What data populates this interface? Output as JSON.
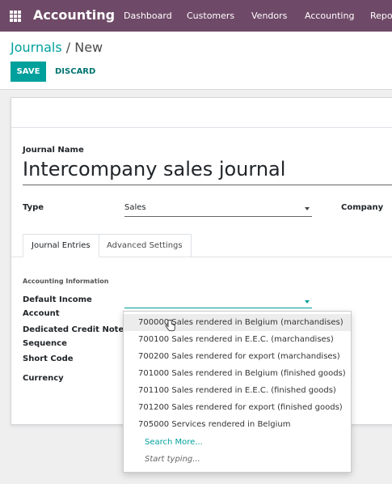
{
  "topbar": {
    "app_title": "Accounting",
    "menu": [
      "Dashboard",
      "Customers",
      "Vendors",
      "Accounting",
      "Reporting"
    ]
  },
  "breadcrumb": {
    "parent": "Journals",
    "separator": " / ",
    "current": "New"
  },
  "buttons": {
    "save": "SAVE",
    "discard": "DISCARD"
  },
  "form": {
    "journal_name_label": "Journal Name",
    "journal_name_value": "Intercompany sales journal",
    "type_label": "Type",
    "type_value": "Sales",
    "company_label": "Company",
    "tabs": [
      "Journal Entries",
      "Advanced Settings"
    ],
    "group_title": "Accounting Information",
    "fields": {
      "default_income_line1": "Default Income",
      "default_income_line2": "Account",
      "credit_note_line1": "Dedicated Credit Note",
      "credit_note_line2": "Sequence",
      "short_code": "Short Code",
      "currency": "Currency"
    }
  },
  "dropdown": {
    "options": [
      "700000 Sales rendered in Belgium (marchandises)",
      "700100 Sales rendered in E.E.C. (marchandises)",
      "700200 Sales rendered for export (marchandises)",
      "701000 Sales rendered in Belgium (finished goods)",
      "701100 Sales rendered in E.E.C. (finished goods)",
      "701200 Sales rendered for export (finished goods)",
      "705000 Services rendered in Belgium"
    ],
    "search_more": "Search More...",
    "start_typing": "Start typing..."
  },
  "colors": {
    "topbar": "#6f4a68",
    "accent": "#00a09d",
    "background": "#efeff0"
  }
}
